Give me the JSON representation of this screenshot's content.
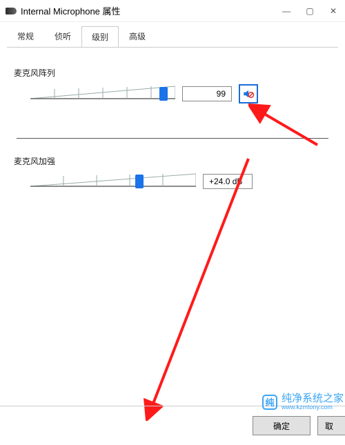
{
  "window": {
    "title": "Internal Microphone 属性"
  },
  "tabs": {
    "items": [
      {
        "label": "常规"
      },
      {
        "label": "侦听"
      },
      {
        "label": "级别"
      },
      {
        "label": "高级"
      }
    ],
    "active_index": 2
  },
  "mic_array": {
    "label": "麦克风阵列",
    "value": "99",
    "slider_percent": 92,
    "muted_icon": "speaker-muted-icon"
  },
  "mic_boost": {
    "label": "麦克风加强",
    "value": "+24.0 dB",
    "slider_percent": 60
  },
  "buttons": {
    "ok": "确定",
    "cancel": "取"
  },
  "watermark": {
    "badge": "纯",
    "line1": "纯净系统之家",
    "line2": "www.kzmtony.com"
  }
}
